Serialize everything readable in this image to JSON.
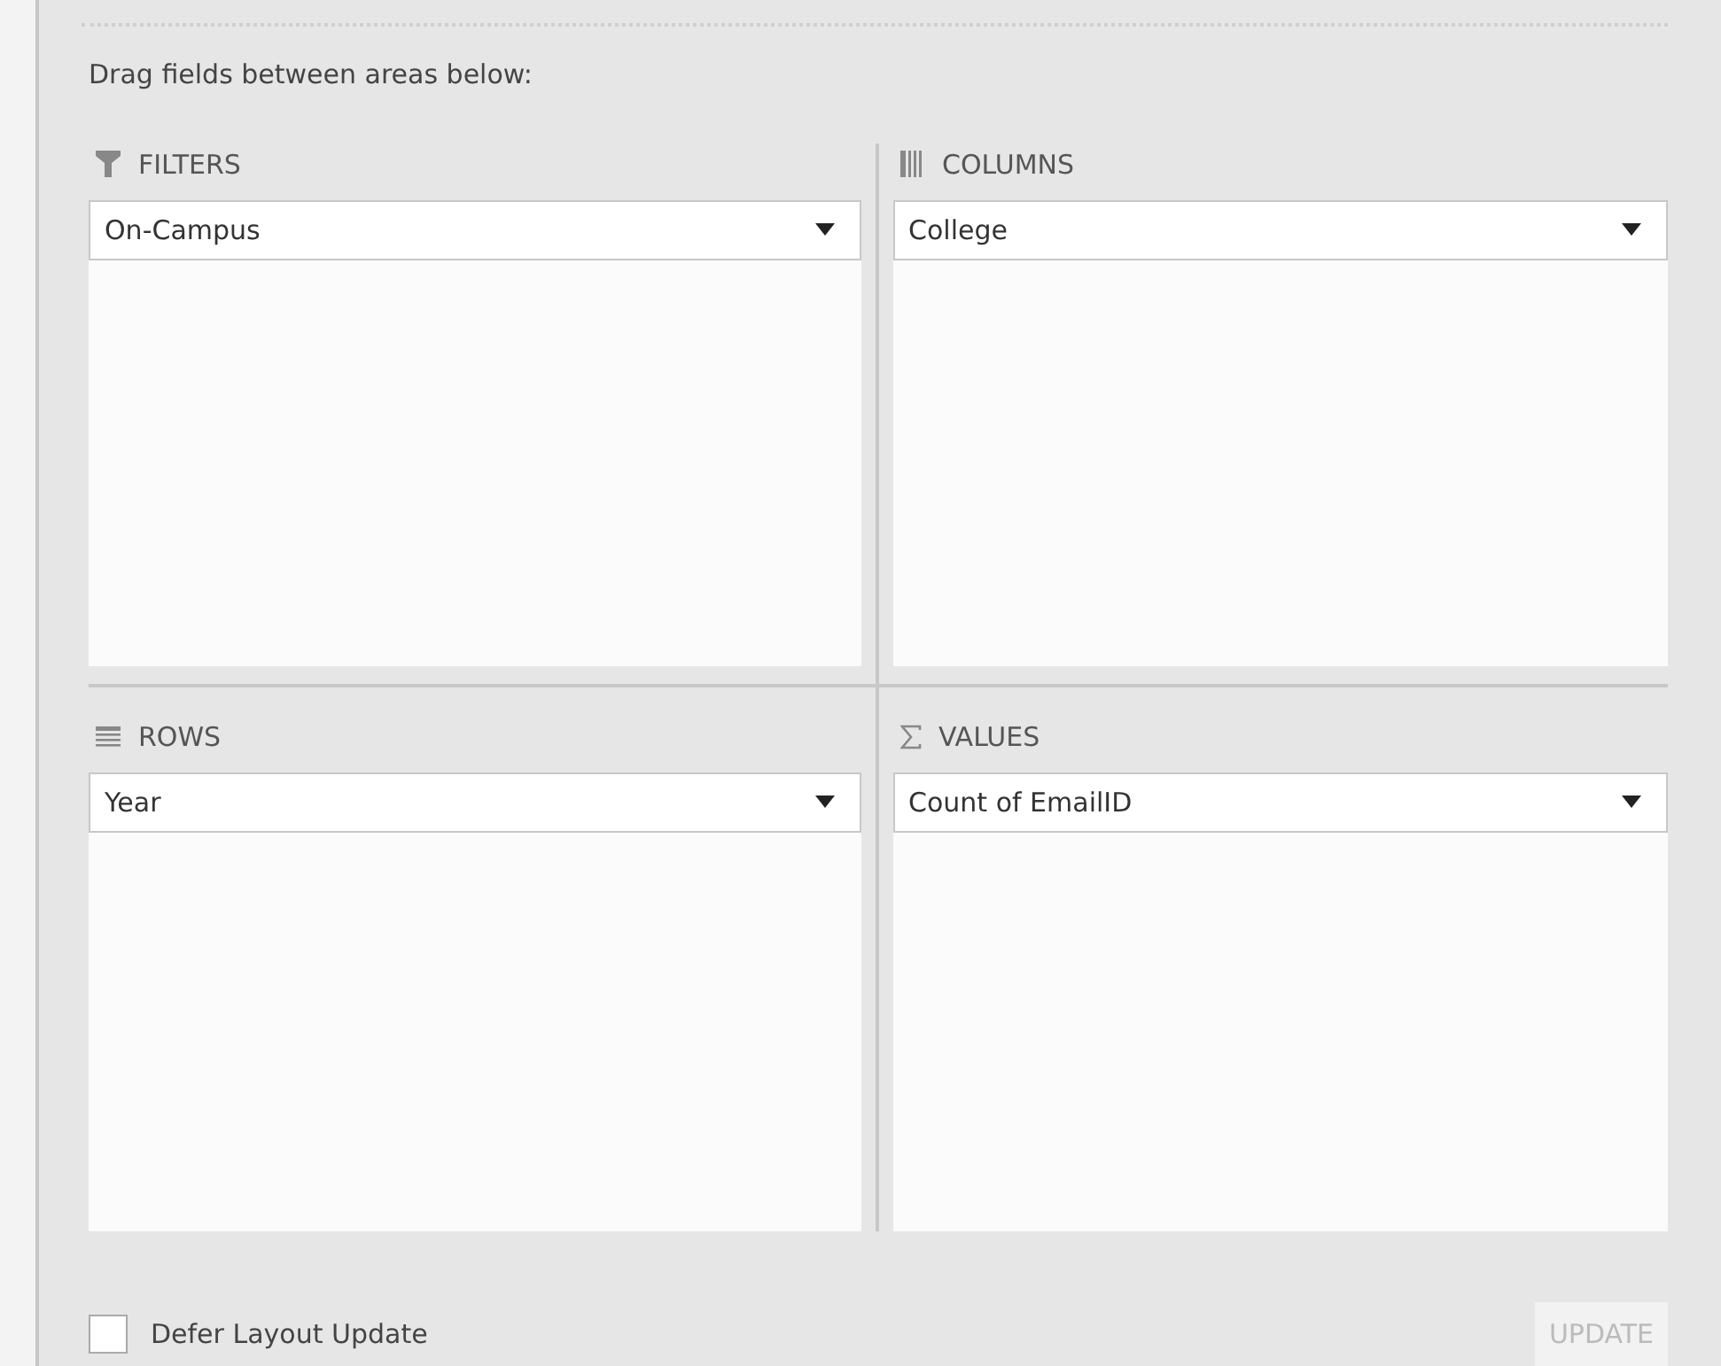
{
  "instruction": "Drag fields between areas below:",
  "areas": [
    {
      "kind": "filters",
      "label": "FILTERS",
      "field": "On-Campus"
    },
    {
      "kind": "columns",
      "label": "COLUMNS",
      "field": "College"
    },
    {
      "kind": "rows",
      "label": "ROWS",
      "field": "Year"
    },
    {
      "kind": "values",
      "label": "VALUES",
      "field": "Count of EmailID"
    }
  ],
  "defer_update": {
    "label": "Defer Layout Update",
    "checked": false
  },
  "update_button": {
    "label": "UPDATE",
    "disabled": true
  }
}
